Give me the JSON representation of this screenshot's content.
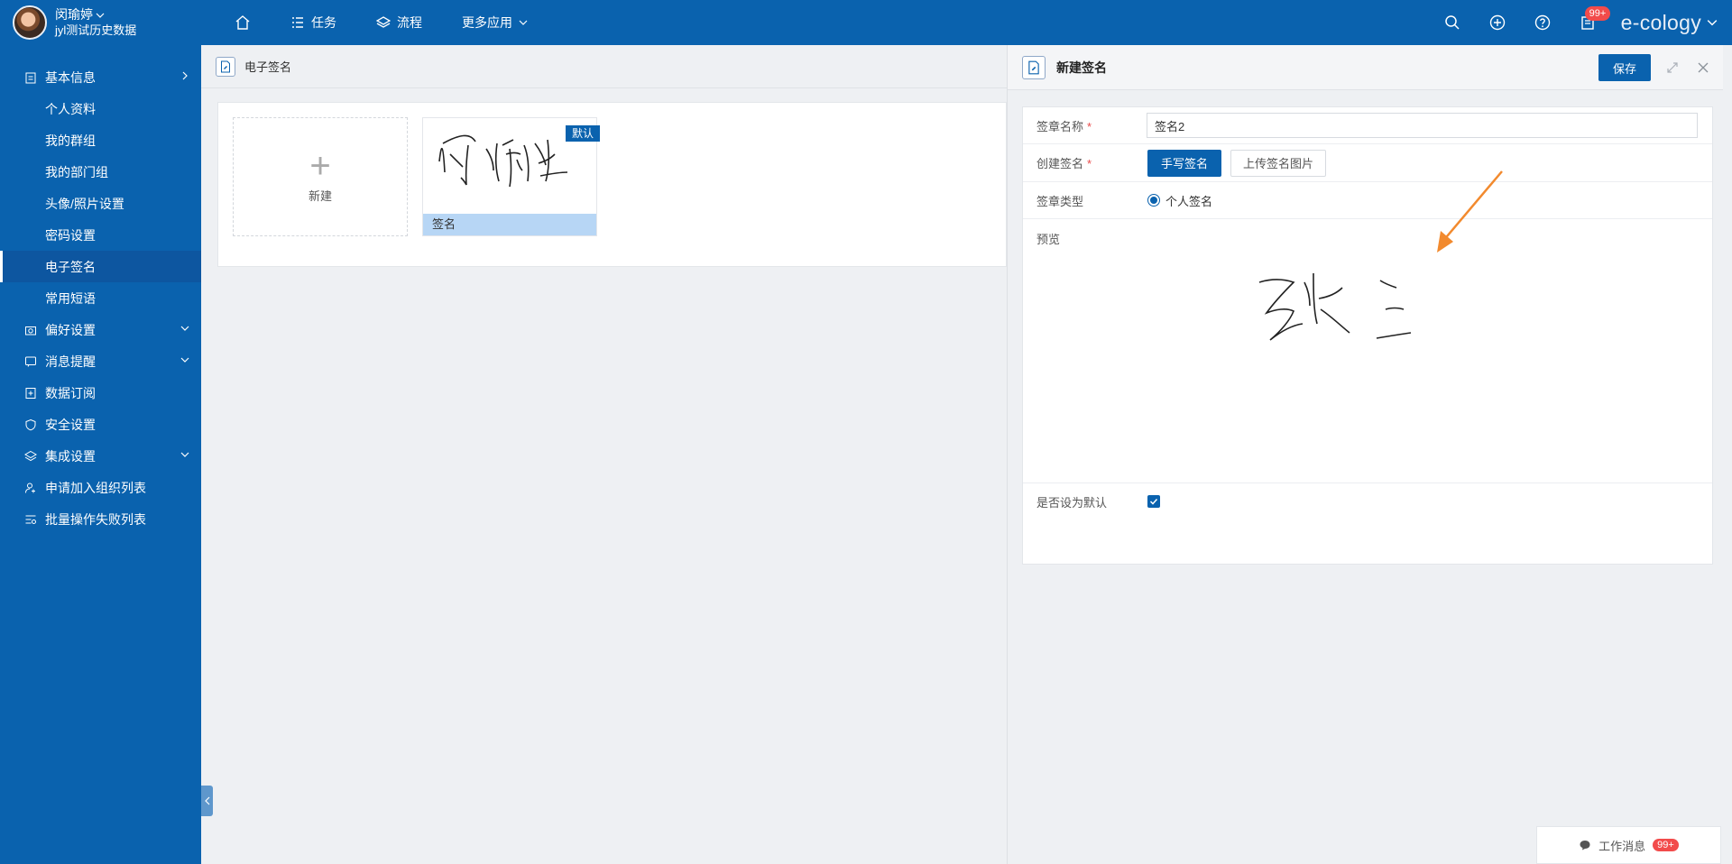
{
  "user": {
    "name": "闵瑜婷",
    "sub": "jyl测试历史数据"
  },
  "nav": {
    "items": [
      {
        "label": "任务",
        "icon": "list-icon"
      },
      {
        "label": "流程",
        "icon": "layers-icon"
      },
      {
        "label": "更多应用",
        "icon": ""
      }
    ]
  },
  "topright": {
    "badge": "99+",
    "brand": "e-cology"
  },
  "sidebar": {
    "group_basic": "基本信息",
    "subs": [
      "个人资料",
      "我的群组",
      "我的部门组",
      "头像/照片设置",
      "密码设置",
      "电子签名",
      "常用短语"
    ],
    "groups": [
      "偏好设置",
      "消息提醒",
      "数据订阅",
      "安全设置",
      "集成设置",
      "申请加入组织列表",
      "批量操作失败列表"
    ]
  },
  "content": {
    "breadcrumb": "电子签名",
    "new_label": "新建",
    "sig_caption": "签名",
    "default_tag": "默认"
  },
  "panel": {
    "title": "新建签名",
    "save": "保存",
    "label_name": "签章名称",
    "name_value": "签名2",
    "label_create": "创建签名",
    "btn_handwrite": "手写签名",
    "btn_upload": "上传签名图片",
    "label_type": "签章类型",
    "type_value": "个人签名",
    "label_preview": "预览",
    "label_default": "是否设为默认"
  },
  "work_msg": {
    "label": "工作消息",
    "badge": "99+"
  },
  "colors": {
    "primary": "#0a62ae",
    "annotation": "#f28a2e",
    "badge": "#f24b4b"
  }
}
